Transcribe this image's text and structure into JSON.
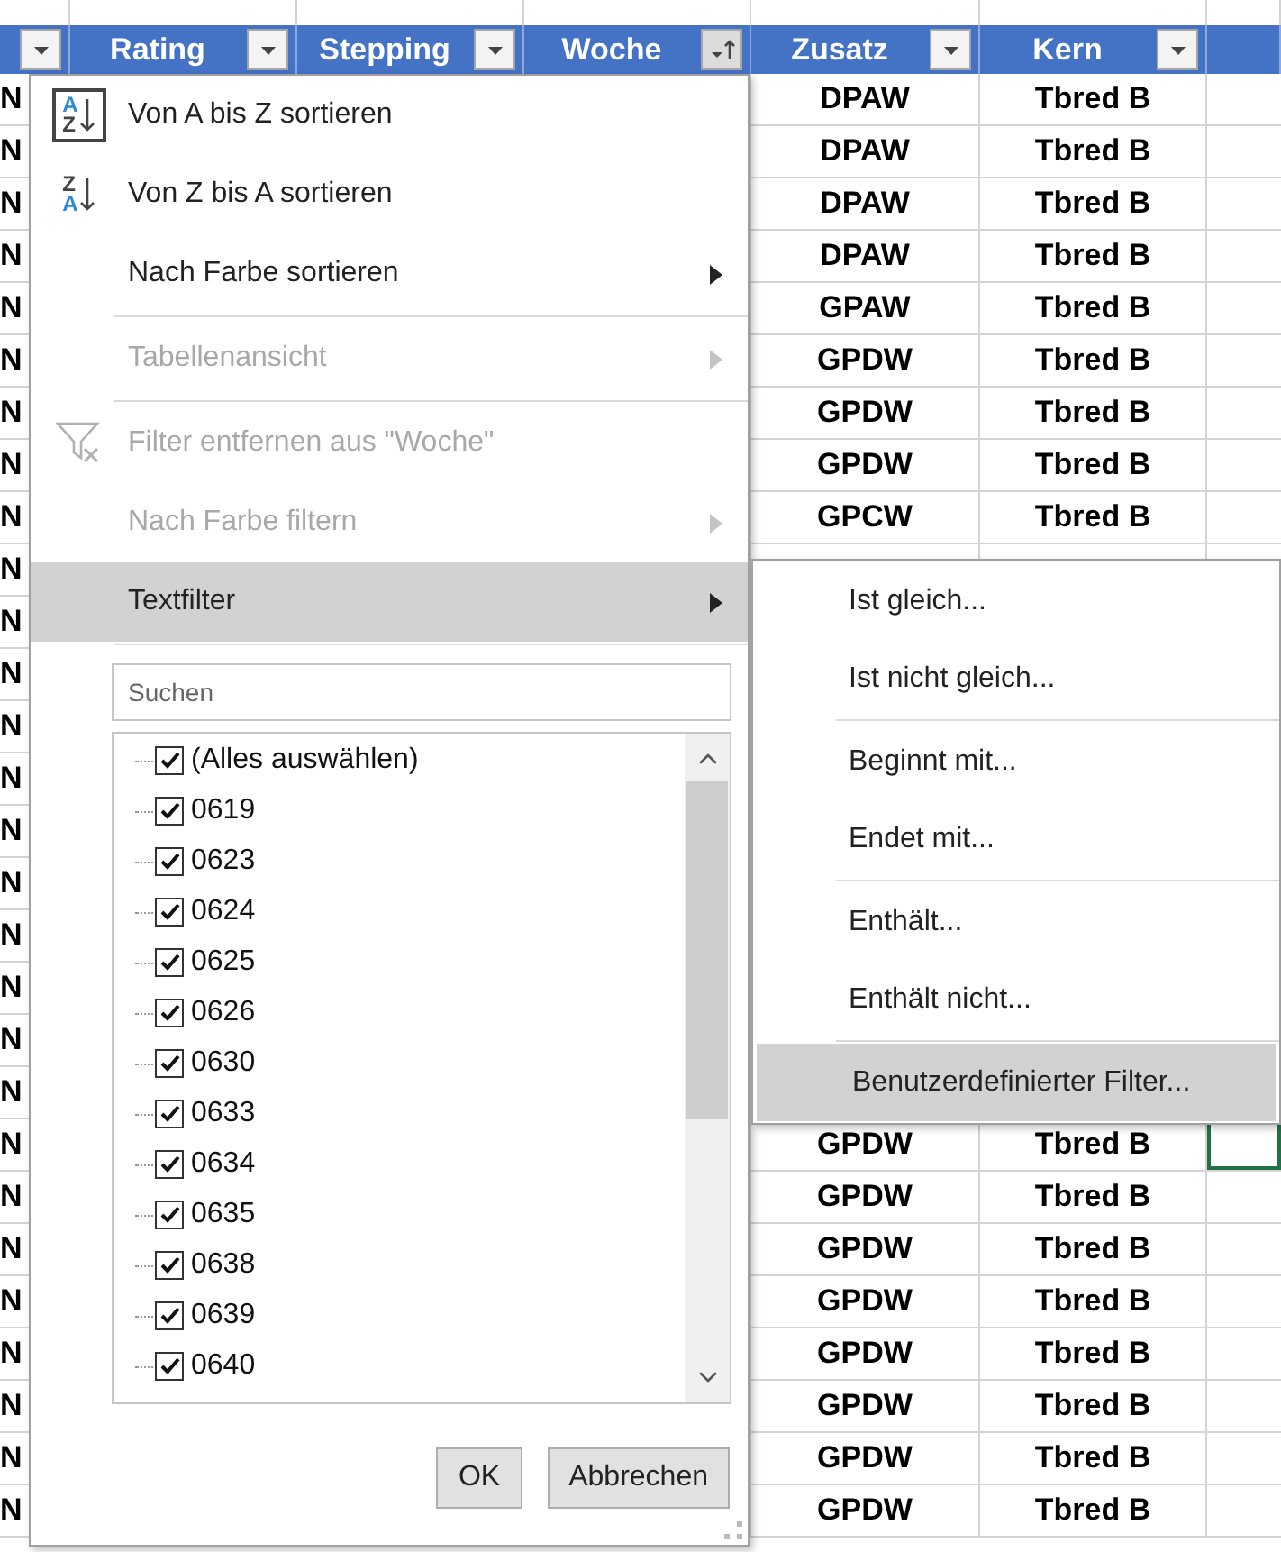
{
  "sheet": {
    "columns": [
      {
        "kind": "filter_only",
        "sorted": false
      },
      {
        "kind": "header",
        "label": "Rating",
        "sorted": false
      },
      {
        "kind": "header",
        "label": "Stepping",
        "sorted": false
      },
      {
        "kind": "header",
        "label": "Woche",
        "sorted": true
      },
      {
        "kind": "header",
        "label": "Zusatz",
        "sorted": false
      },
      {
        "kind": "header",
        "label": "Kern",
        "sorted": false
      },
      {
        "kind": "empty"
      }
    ],
    "col_a": [
      "N",
      "N",
      "N",
      "N",
      "N",
      "N",
      "N",
      "N",
      "N",
      "N",
      "N",
      "N",
      "N",
      "N",
      "N",
      "N",
      "N",
      "N",
      "N",
      "N",
      "N",
      "N",
      "N",
      "N",
      "N",
      "N",
      "N",
      "N"
    ],
    "upper_rows": [
      {
        "zusatz": "DPAW",
        "kern": "Tbred B",
        "selected": false
      },
      {
        "zusatz": "DPAW",
        "kern": "Tbred B",
        "selected": false
      },
      {
        "zusatz": "DPAW",
        "kern": "Tbred B",
        "selected": false
      },
      {
        "zusatz": "DPAW",
        "kern": "Tbred B",
        "selected": false
      },
      {
        "zusatz": "GPAW",
        "kern": "Tbred B",
        "selected": false
      },
      {
        "zusatz": "GPDW",
        "kern": "Tbred B",
        "selected": false
      },
      {
        "zusatz": "GPDW",
        "kern": "Tbred B",
        "selected": false
      },
      {
        "zusatz": "GPDW",
        "kern": "Tbred B",
        "selected": false
      },
      {
        "zusatz": "GPCW",
        "kern": "Tbred B",
        "selected": false
      }
    ],
    "lower_rows": [
      {
        "zusatz": "GPDW",
        "kern": "Tbred B",
        "selected": true
      },
      {
        "zusatz": "GPDW",
        "kern": "Tbred B",
        "selected": false
      },
      {
        "zusatz": "GPDW",
        "kern": "Tbred B",
        "selected": false
      },
      {
        "zusatz": "GPDW",
        "kern": "Tbred B",
        "selected": false
      },
      {
        "zusatz": "GPDW",
        "kern": "Tbred B",
        "selected": false
      },
      {
        "zusatz": "GPDW",
        "kern": "Tbred B",
        "selected": false
      },
      {
        "zusatz": "GPDW",
        "kern": "Tbred B",
        "selected": false
      },
      {
        "zusatz": "GPDW",
        "kern": "Tbred B",
        "selected": false
      }
    ]
  },
  "filter_menu": {
    "items": [
      {
        "kind": "sort",
        "icon_letters": [
          {
            "text": "A",
            "accent": true
          },
          {
            "text": "Z",
            "accent": false
          }
        ],
        "label": "Von A bis Z sortieren",
        "checked": true,
        "disabled": false,
        "submenu": false,
        "selected": false
      },
      {
        "kind": "sort",
        "icon_letters": [
          {
            "text": "Z",
            "accent": false
          },
          {
            "text": "A",
            "accent": true
          }
        ],
        "label": "Von Z bis A sortieren",
        "checked": false,
        "disabled": false,
        "submenu": false,
        "selected": false
      },
      {
        "kind": "item",
        "label": "Nach Farbe sortieren",
        "disabled": false,
        "submenu": true,
        "selected": false
      },
      {
        "kind": "separator"
      },
      {
        "kind": "item",
        "label": "Tabellenansicht",
        "disabled": true,
        "submenu": true,
        "selected": false
      },
      {
        "kind": "separator"
      },
      {
        "kind": "clear_filter",
        "label": "Filter entfernen aus \"Woche\"",
        "disabled": true,
        "submenu": false,
        "selected": false
      },
      {
        "kind": "item",
        "label": "Nach Farbe filtern",
        "disabled": true,
        "submenu": true,
        "selected": false
      },
      {
        "kind": "item",
        "label": "Textfilter",
        "disabled": false,
        "submenu": true,
        "selected": true
      },
      {
        "kind": "separator"
      }
    ],
    "search": {
      "placeholder": "Suchen"
    },
    "values": [
      {
        "label": "(Alles auswählen)",
        "checked": true
      },
      {
        "label": "0619",
        "checked": true
      },
      {
        "label": "0623",
        "checked": true
      },
      {
        "label": "0624",
        "checked": true
      },
      {
        "label": "0625",
        "checked": true
      },
      {
        "label": "0626",
        "checked": true
      },
      {
        "label": "0630",
        "checked": true
      },
      {
        "label": "0633",
        "checked": true
      },
      {
        "label": "0634",
        "checked": true
      },
      {
        "label": "0635",
        "checked": true
      },
      {
        "label": "0638",
        "checked": true
      },
      {
        "label": "0639",
        "checked": true
      },
      {
        "label": "0640",
        "checked": true
      }
    ],
    "buttons": [
      "OK",
      "Abbrechen"
    ]
  },
  "text_filter_submenu": {
    "items": [
      {
        "kind": "item",
        "label": "Ist gleich...",
        "selected": false
      },
      {
        "kind": "item",
        "label": "Ist nicht gleich...",
        "selected": false
      },
      {
        "kind": "separator"
      },
      {
        "kind": "item",
        "label": "Beginnt mit...",
        "selected": false
      },
      {
        "kind": "item",
        "label": "Endet mit...",
        "selected": false
      },
      {
        "kind": "separator"
      },
      {
        "kind": "item",
        "label": "Enthält...",
        "selected": false
      },
      {
        "kind": "item",
        "label": "Enthält nicht...",
        "selected": false
      },
      {
        "kind": "separator"
      },
      {
        "kind": "item",
        "label": "Benutzerdefinierter Filter...",
        "selected": true
      }
    ]
  }
}
